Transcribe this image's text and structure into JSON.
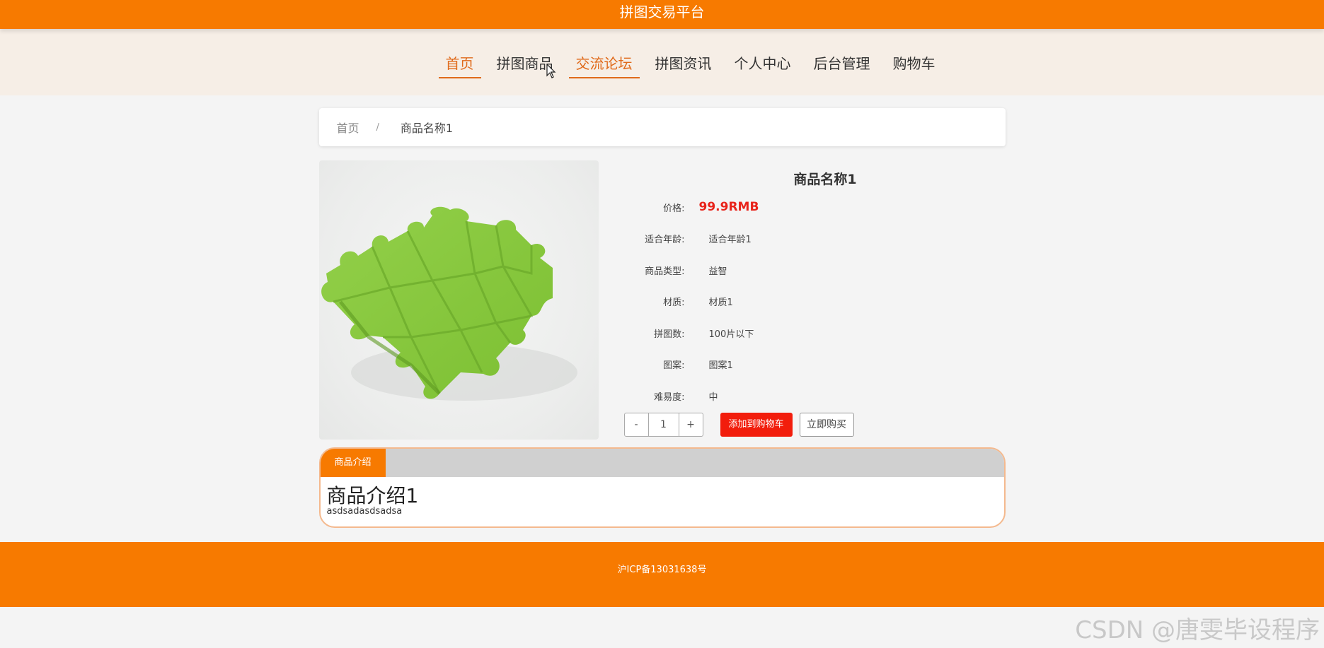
{
  "header": {
    "title": "拼图交易平台"
  },
  "nav": {
    "items": [
      {
        "label": "首页"
      },
      {
        "label": "拼图商品"
      },
      {
        "label": "交流论坛"
      },
      {
        "label": "拼图资讯"
      },
      {
        "label": "个人中心"
      },
      {
        "label": "后台管理"
      },
      {
        "label": "购物车"
      }
    ],
    "active": [
      "首页",
      "交流论坛"
    ]
  },
  "breadcrumb": {
    "home": "首页",
    "separator": "/",
    "current": "商品名称1"
  },
  "product": {
    "name": "商品名称1",
    "image": "green-puzzle-image",
    "fields": [
      {
        "key": "价格:",
        "value": "99.9RMB"
      },
      {
        "key": "适合年龄:",
        "value": "适合年龄1"
      },
      {
        "key": "商品类型:",
        "value": "益智"
      },
      {
        "key": "材质:",
        "value": "材质1"
      },
      {
        "key": "拼图数:",
        "value": "100片以下"
      },
      {
        "key": "图案:",
        "value": "图案1"
      },
      {
        "key": "难易度:",
        "value": "中"
      }
    ],
    "quantity": {
      "minus": "-",
      "value": "1",
      "plus": "+"
    },
    "add_to_cart": "添加到购物车",
    "buy_now": "立即购买"
  },
  "intro": {
    "tab": "商品介绍",
    "heading": "商品介绍1",
    "text": "asdsadasdsadsa"
  },
  "footer": {
    "icp": "沪ICP备13031638号"
  },
  "watermark": "CSDN @唐雯毕设程序",
  "colors": {
    "accent": "#f77a00",
    "price": "#e8231a",
    "nav_active": "#e06a1a"
  }
}
